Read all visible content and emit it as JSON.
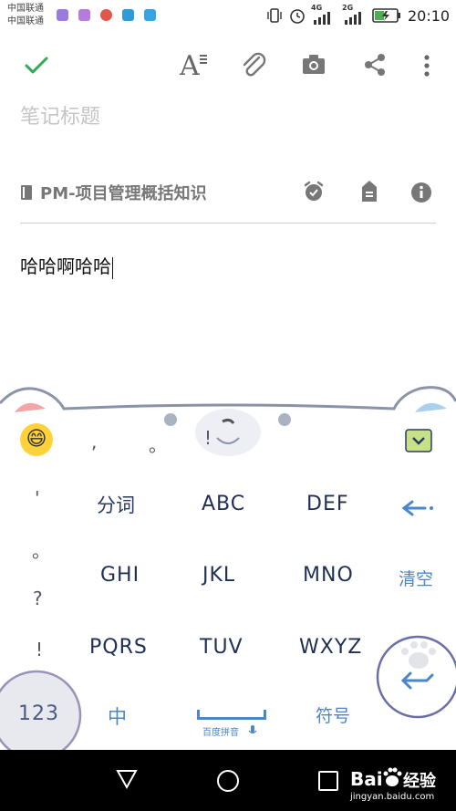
{
  "status_bar": {
    "carrier1": "中国联通",
    "carrier2": "中国联通",
    "net1": "4G",
    "net2": "2G",
    "time": "20:10"
  },
  "toolbar": {
    "icons": [
      "check-icon",
      "text-format-icon",
      "attachment-icon",
      "camera-icon",
      "share-icon",
      "more-icon"
    ]
  },
  "note": {
    "title_placeholder": "笔记标题",
    "notebook": "PM-项目管理概括知识",
    "body": "哈哈啊哈哈"
  },
  "keyboard": {
    "candidates": [
      ",",
      "。",
      "!"
    ],
    "punctuation": [
      "'",
      "。",
      "?",
      "!"
    ],
    "keys_row1": [
      "分词",
      "ABC",
      "DEF"
    ],
    "keys_row2": [
      "GHI",
      "JKL",
      "MNO"
    ],
    "keys_row3": [
      "PQRS",
      "TUV",
      "WXYZ"
    ],
    "clear": "清空",
    "num": "123",
    "zh": "中",
    "symbol": "符号",
    "space_label": "百度拼音"
  },
  "watermark": {
    "brand": "Bai",
    "brand2": "经验",
    "url": "jingyan.baidu.com"
  },
  "colors": {
    "accent_green": "#2eaa55",
    "keyboard_outline": "#8a93a8",
    "keyboard_blue": "#4a86c8"
  }
}
